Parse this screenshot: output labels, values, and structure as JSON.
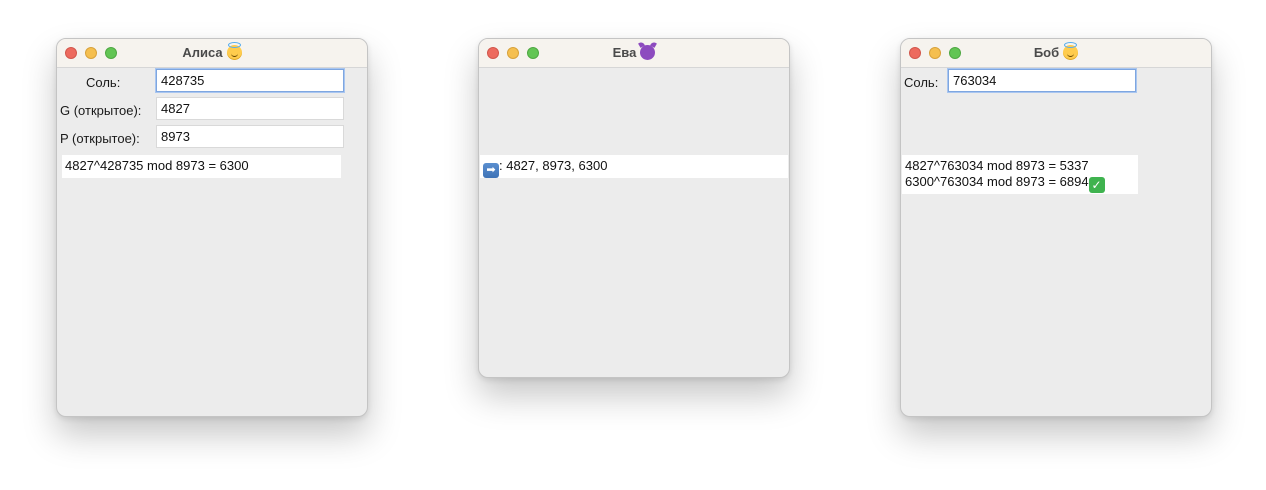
{
  "alice": {
    "title": "Алиса",
    "title_emoji": "smiling-face-with-halo-icon",
    "salt_label": "Соль:",
    "salt_value": "428735",
    "g_label": "G (открытое):",
    "g_value": "4827",
    "p_label": "P (открытое):",
    "p_value": "8973",
    "result": "4827^428735 mod 8973 = 6300"
  },
  "eve": {
    "title": "Ева",
    "title_emoji": "smiling-face-with-horns-icon",
    "intercept_icon": "right-arrow-icon",
    "intercept_text": ": 4827, 8973, 6300"
  },
  "bob": {
    "title": "Боб",
    "title_emoji": "smiling-face-with-halo-icon",
    "salt_label": "Соль:",
    "salt_value": "763034",
    "result_line1": "4827^763034 mod 8973 = 5337",
    "result_line2": "6300^763034 mod 8973 = 6894",
    "check_icon": "check-mark-button-icon"
  },
  "colors": {
    "close": "#ed6a5e",
    "minimize": "#f5bf4f",
    "zoom": "#62c554",
    "focus_ring": "#7ea6e0",
    "window_bg": "#ececec"
  }
}
